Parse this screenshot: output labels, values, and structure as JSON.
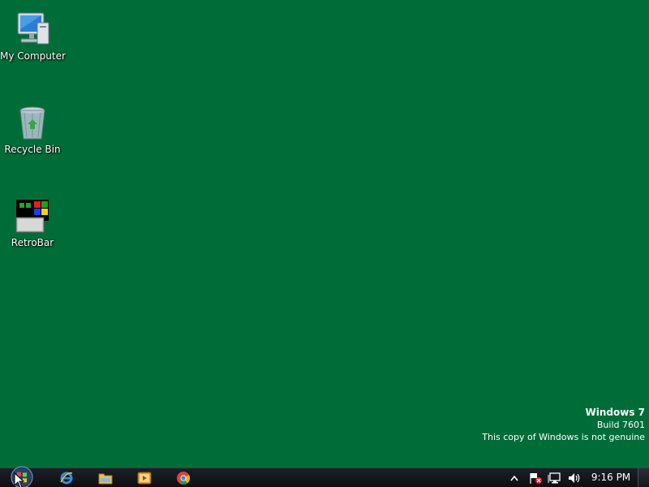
{
  "desktop": {
    "background_color": "#006d38",
    "icons": [
      {
        "label": "My Computer",
        "icon": "computer-icon"
      },
      {
        "label": "Recycle Bin",
        "icon": "recycle-bin-icon"
      },
      {
        "label": "RetroBar",
        "icon": "retrobar-icon"
      }
    ]
  },
  "watermark": {
    "title": "Windows 7",
    "build": "Build 7601",
    "notice": "This copy of Windows is not genuine"
  },
  "taskbar": {
    "start_icon": "windows-start-orb-icon",
    "pinned": [
      {
        "icon": "internet-explorer-icon"
      },
      {
        "icon": "file-explorer-icon"
      },
      {
        "icon": "media-player-icon"
      },
      {
        "icon": "chrome-icon"
      }
    ],
    "tray": {
      "icons": [
        "show-hidden-icons-arrow",
        "action-center-flag-icon",
        "network-icon",
        "volume-icon"
      ],
      "clock": "9:16 PM"
    }
  }
}
